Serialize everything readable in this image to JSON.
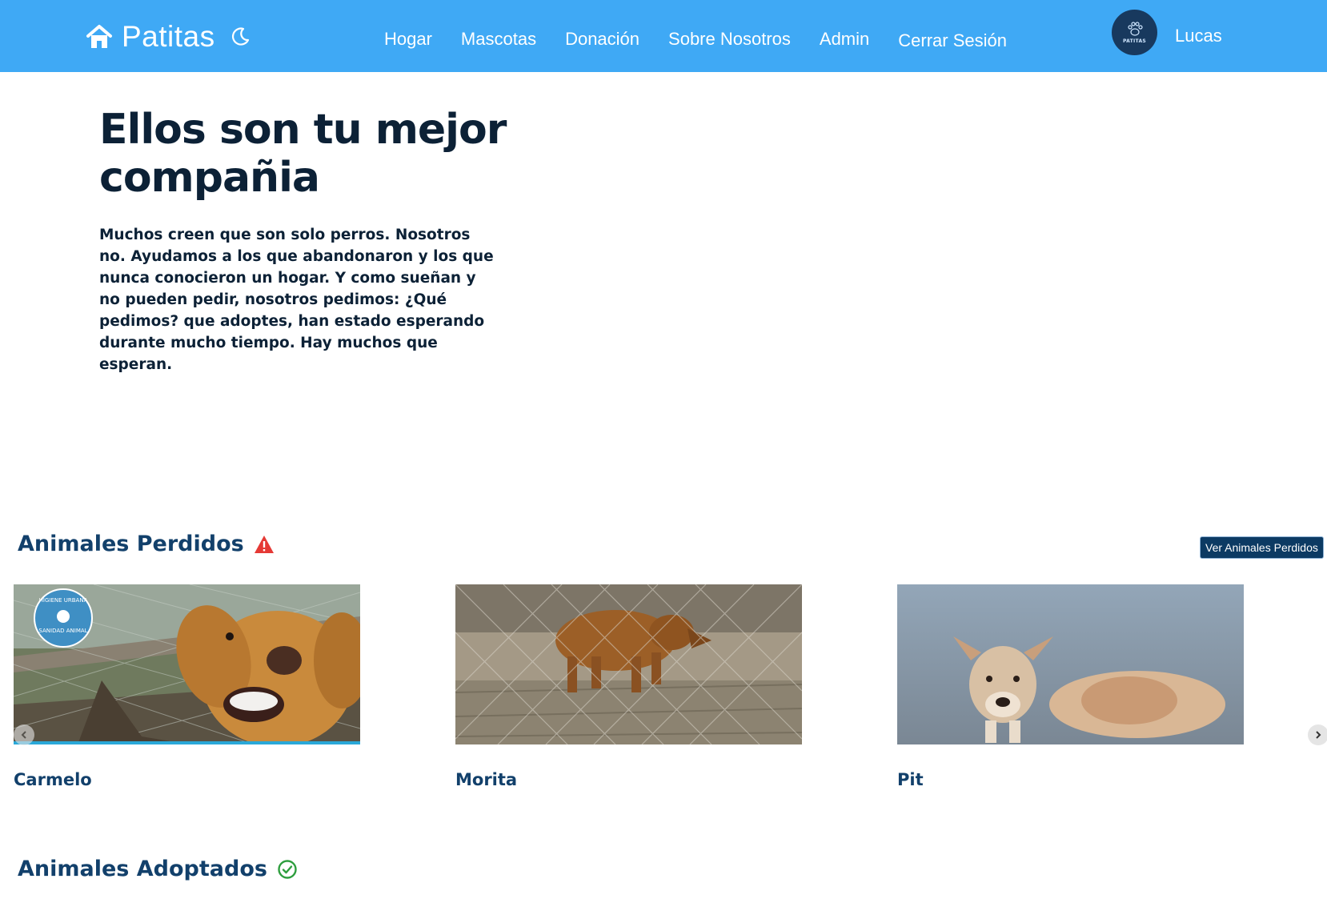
{
  "nav": {
    "brand": "Patitas",
    "links": [
      "Hogar",
      "Mascotas",
      "Donación",
      "Sobre Nosotros",
      "Admin",
      "Cerrar Sesión"
    ],
    "avatar_label": "PATITAS",
    "username": "Lucas"
  },
  "hero": {
    "title": "Ellos son tu mejor compañia",
    "text": "Muchos creen que son solo perros. Nosotros no. Ayudamos a los que abandonaron y los que nunca conocieron un hogar. Y como sueñan y no pueden pedir, nosotros pedimos: ¿Qué pedimos? que adoptes, han estado esperando durante mucho tiempo. Hay muchos que esperan."
  },
  "lost": {
    "title": "Animales Perdidos",
    "button": "Ver Animales Perdidos",
    "cards": [
      {
        "name": "Carmelo",
        "badge_top": "HIGIENE URBANA",
        "badge_bottom": "SANIDAD ANIMAL"
      },
      {
        "name": "Morita"
      },
      {
        "name": "Pit"
      }
    ]
  },
  "adopted": {
    "title": "Animales Adoptados"
  },
  "colors": {
    "navbar": "#3fa9f5",
    "heading": "#0c2136",
    "section": "#12406b",
    "button": "#0c3a63",
    "warning": "#e53935",
    "success": "#2e9e3e"
  },
  "icons": [
    "home-icon",
    "moon-icon",
    "paw-icon",
    "warning-icon",
    "check-circle-icon",
    "chevron-left-icon",
    "chevron-right-icon"
  ]
}
